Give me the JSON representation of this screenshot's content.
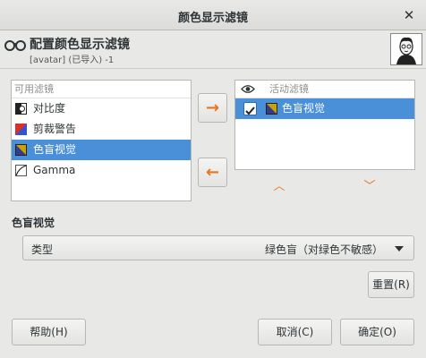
{
  "window": {
    "title": "颜色显示滤镜"
  },
  "header": {
    "title": "配置颜色显示滤镜",
    "subtitle": "[avatar] (已导入) -1"
  },
  "available": {
    "heading": "可用滤镜",
    "items": [
      {
        "label": "对比度",
        "icon": "contrast-icon",
        "selected": false
      },
      {
        "label": "剪裁警告",
        "icon": "clip-warning-icon",
        "selected": false
      },
      {
        "label": "色盲视觉",
        "icon": "color-deficient-icon",
        "selected": true
      },
      {
        "label": "Gamma",
        "icon": "gamma-icon",
        "selected": false
      }
    ]
  },
  "active": {
    "heading": "活动滤镜",
    "items": [
      {
        "label": "色盲视觉",
        "checked": true,
        "selected": true
      }
    ]
  },
  "section": {
    "label": "色盲视觉"
  },
  "type_select": {
    "label": "类型",
    "value": "绿色盲（对绿色不敏感）"
  },
  "buttons": {
    "reset": "重置(R)",
    "help": "帮助(H)",
    "cancel": "取消(C)",
    "ok": "确定(O)"
  },
  "colors": {
    "selection": "#4a90d9",
    "arrow_accent": "#e8761c"
  }
}
